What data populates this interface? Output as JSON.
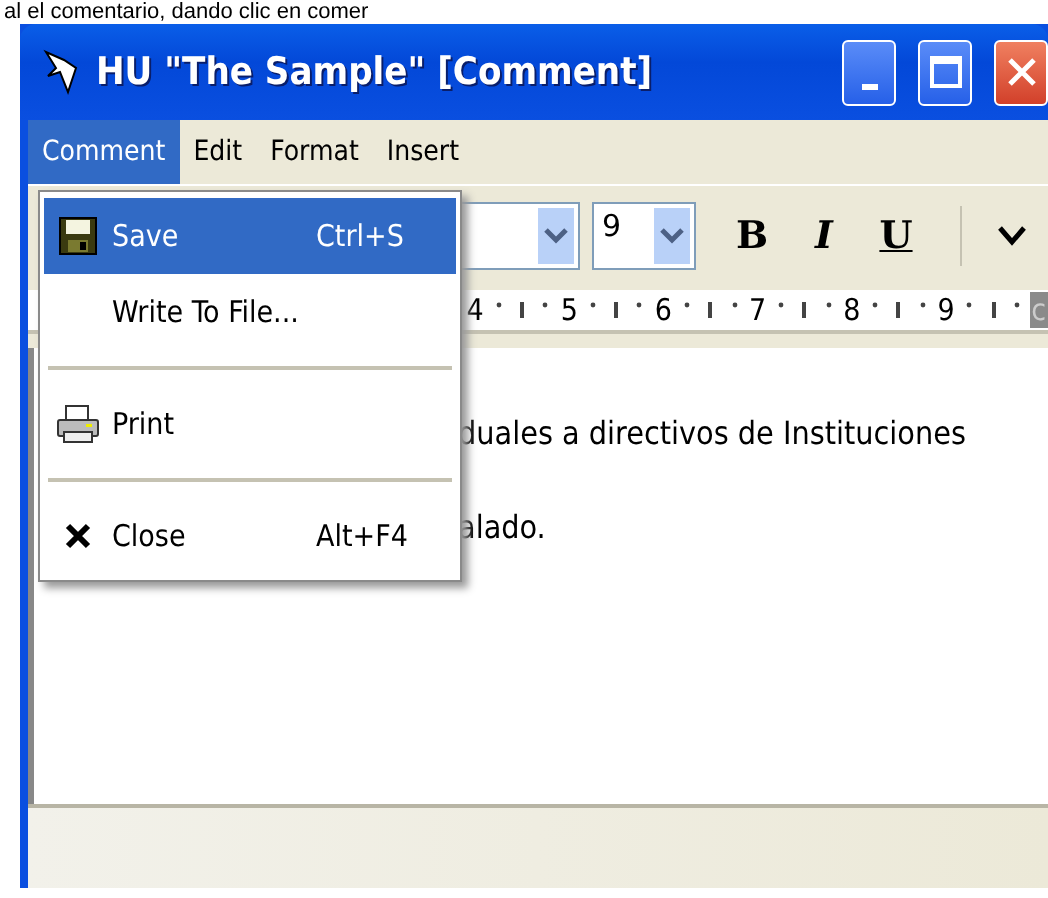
{
  "background_text": "al el comentario, dando clic en comer",
  "window": {
    "title": "HU \"The Sample\" [Comment]"
  },
  "menubar": [
    {
      "label": "Comment",
      "selected": true
    },
    {
      "label": "Edit",
      "selected": false
    },
    {
      "label": "Format",
      "selected": false
    },
    {
      "label": "Insert",
      "selected": false
    }
  ],
  "menu": [
    {
      "kind": "command",
      "label": "Save",
      "shortcut": "Ctrl+S",
      "selected": true
    },
    {
      "kind": "command",
      "label": "Write To File...",
      "selected": false
    },
    {
      "kind": "separator"
    },
    {
      "kind": "command",
      "label": "Print",
      "selected": false
    },
    {
      "kind": "separator"
    },
    {
      "kind": "command",
      "label": "Close",
      "shortcut": "Alt+F4",
      "selected": false
    }
  ],
  "toolbar": {
    "font_size": "9",
    "format_buttons": [
      "B",
      "I",
      "U"
    ]
  },
  "ruler": {
    "labels": [
      "4",
      "5",
      "6",
      "7",
      "8",
      "9"
    ],
    "unit": "c"
  },
  "document": {
    "lines": [
      "duales a directivos de Instituciones",
      "alado."
    ]
  }
}
